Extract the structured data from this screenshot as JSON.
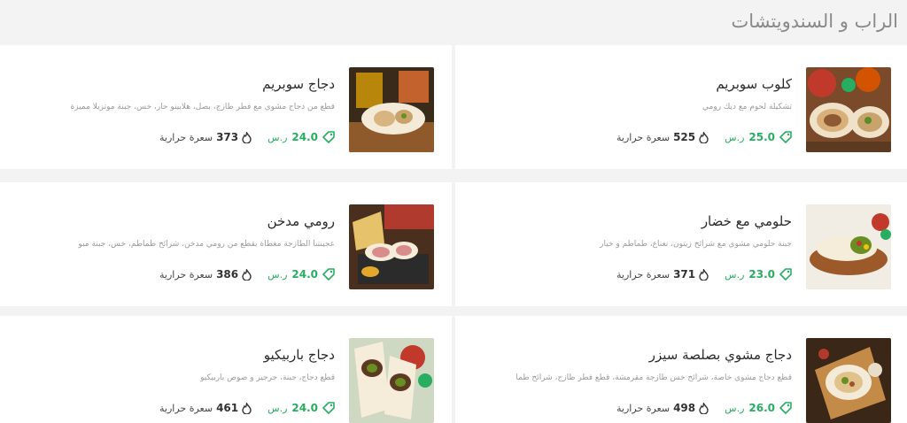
{
  "section": {
    "title": "الراب و السندويتشات"
  },
  "items": [
    {
      "name": "كلوب سوبريم",
      "description": "تشكيلة لحوم مع ديك رومي",
      "price": "25.0",
      "currency": "ر.س",
      "calories": "525",
      "calories_label": "سعرة حرارية"
    },
    {
      "name": "دجاج سوبريم",
      "description": "قطع من دجاج مشوي مع فطر طازج، بصل، هلابينو حار، خس، جبنة موتزيلا مميزة",
      "price": "24.0",
      "currency": "ر.س",
      "calories": "373",
      "calories_label": "سعرة حرارية"
    },
    {
      "name": "حلومي مع خضار",
      "description": "جبنة حلومي مشوي مع شرائح زيتون، نعناع، طماطم و خيار",
      "price": "23.0",
      "currency": "ر.س",
      "calories": "371",
      "calories_label": "سعرة حرارية"
    },
    {
      "name": "رومي مدخن",
      "description": "عجينتنا الطازجة مغطاة بقطع من رومي مدخن، شرائح طماطم، خس، جبنة مبو",
      "price": "24.0",
      "currency": "ر.س",
      "calories": "386",
      "calories_label": "سعرة حرارية"
    },
    {
      "name": "دجاج مشوي بصلصة سيزر",
      "description": "قطع دجاج مشوي خاصة، شرائح خس طازجة مقرمشة، قطع فطر طازج، شرائح طما",
      "price": "26.0",
      "currency": "ر.س",
      "calories": "498",
      "calories_label": "سعرة حرارية"
    },
    {
      "name": "دجاج باربيكيو",
      "description": "قطع دجاج، جبنة، جرجير و صوص باربيكيو",
      "price": "24.0",
      "currency": "ر.س",
      "calories": "461",
      "calories_label": "سعرة حرارية"
    }
  ]
}
